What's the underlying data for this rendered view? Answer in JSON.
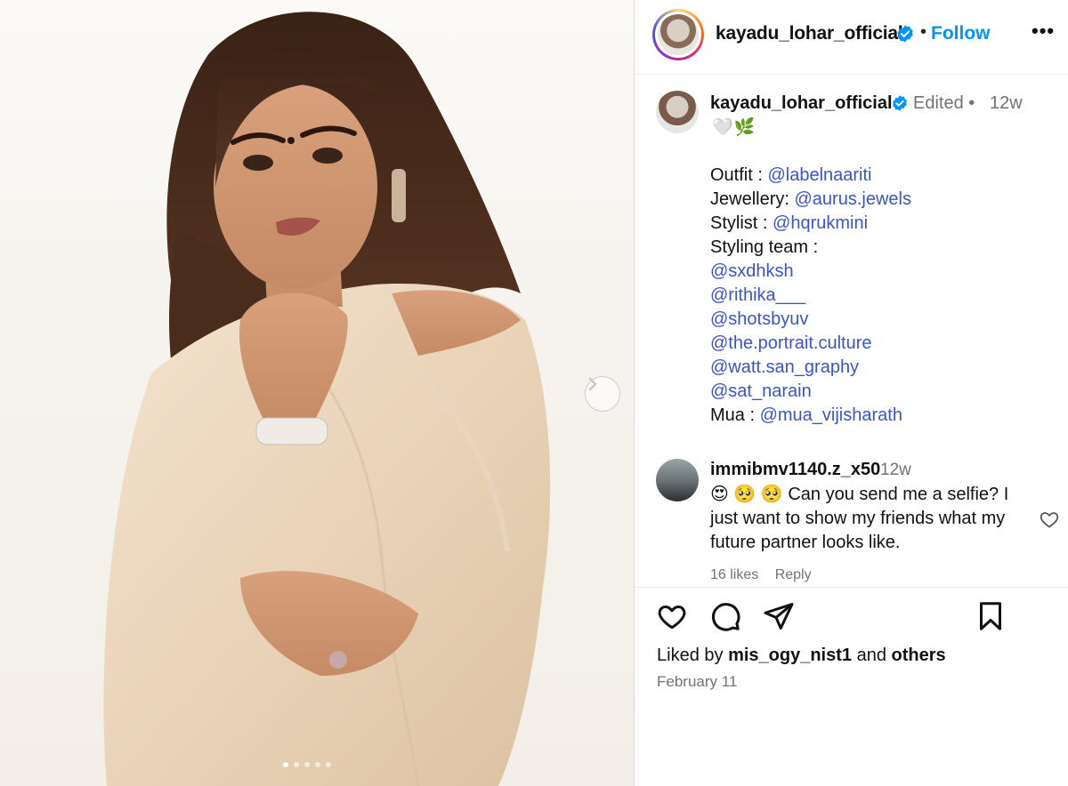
{
  "header": {
    "username": "kayadu_lohar_official",
    "bullet": "•",
    "follow_label": "Follow",
    "more_label": "•••"
  },
  "caption": {
    "username": "kayadu_lohar_official",
    "edited": "Edited •",
    "time": "12w",
    "emoji": "🤍🌿",
    "lines": [
      {
        "prefix": "Outfit : ",
        "mention": "@labelnaariti"
      },
      {
        "prefix": "Jewellery: ",
        "mention": "@aurus.jewels"
      },
      {
        "prefix": "Stylist : ",
        "mention": "@hqrukmini"
      },
      {
        "prefix": "Styling team :",
        "mention": ""
      },
      {
        "prefix": "",
        "mention": "@sxdhksh"
      },
      {
        "prefix": "",
        "mention": "@rithika___"
      },
      {
        "prefix": "",
        "mention": "@shotsbyuv"
      },
      {
        "prefix": "",
        "mention": "@the.portrait.culture"
      },
      {
        "prefix": "",
        "mention": "@watt.san_graphy"
      },
      {
        "prefix": "",
        "mention": "@sat_narain"
      },
      {
        "prefix": "Mua : ",
        "mention": "@mua_vijisharath"
      }
    ]
  },
  "comment": {
    "username": "immibmv1140.z_x50",
    "time": "12w",
    "text": "😍 🥺 🥺 Can you send me a selfie? I just want to show my friends what my future partner looks like.",
    "likes": "16 likes",
    "reply_label": "Reply"
  },
  "footer": {
    "liked_by_prefix": "Liked by ",
    "liked_by_user": "mis_ogy_nist1",
    "liked_by_and": " and ",
    "liked_by_others": "others",
    "date": "February 11"
  },
  "colors": {
    "accent": "#0095f6",
    "mention": "#3a55c8",
    "muted": "#737373"
  },
  "icons": {
    "verified": "verified-badge-icon",
    "next": "chevron-right-icon",
    "like": "heart-icon",
    "comment": "comment-bubble-icon",
    "share": "paper-plane-icon",
    "save": "bookmark-icon"
  },
  "carousel": {
    "slide_count": 5,
    "active_slide": 1
  }
}
